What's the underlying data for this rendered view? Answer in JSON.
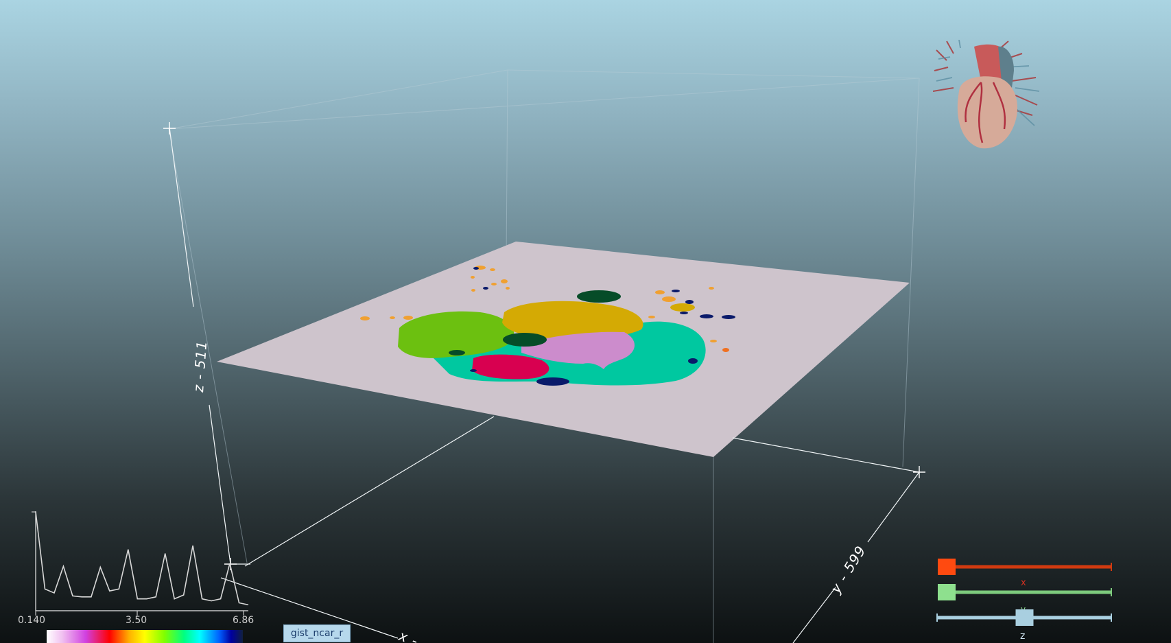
{
  "axes": {
    "z_label": "z - 511",
    "y_label": "y - 599",
    "x_label": "x -"
  },
  "histogram": {
    "min_label": "0.140",
    "mid_label": "3.50",
    "max_label": "6.86",
    "values": [
      1.0,
      0.22,
      0.18,
      0.45,
      0.15,
      0.14,
      0.14,
      0.44,
      0.2,
      0.22,
      0.62,
      0.12,
      0.12,
      0.14,
      0.58,
      0.12,
      0.16,
      0.66,
      0.12,
      0.1,
      0.12,
      0.48,
      0.08,
      0.06
    ]
  },
  "colormap": {
    "name": "gist_ncar_r"
  },
  "sliders": {
    "x": {
      "label": "x",
      "value": 0.0,
      "color": "#ff4a10"
    },
    "y": {
      "label": "y",
      "value": 0.0,
      "color": "#8ee08e"
    },
    "z": {
      "label": "z",
      "value": 0.5,
      "color": "#a9cfe0"
    }
  },
  "colors": {
    "plane": "#cec4cc",
    "segment_green": "#6cc010",
    "segment_yellow": "#d4aa04",
    "segment_teal": "#00c8a0",
    "segment_pink": "#cc8ccc",
    "segment_red": "#d80050",
    "segment_darkgreen": "#064c28",
    "segment_navy": "#0a1a6a",
    "segment_orange": "#f0a030"
  }
}
